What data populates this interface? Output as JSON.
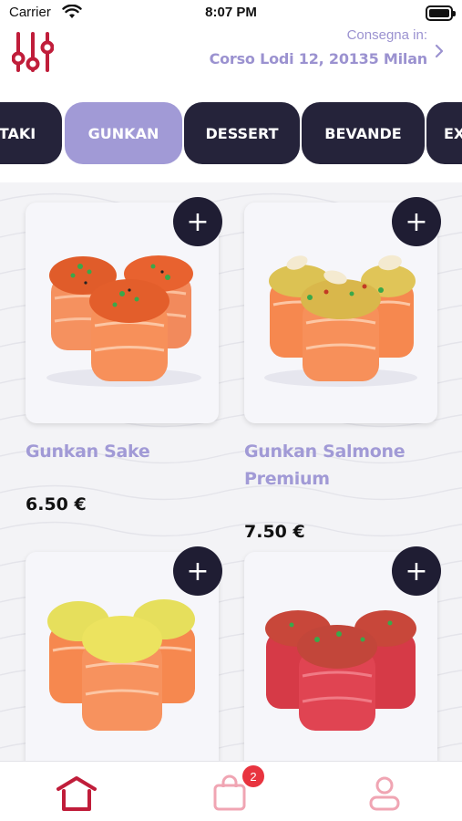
{
  "status_bar": {
    "carrier": "Carrier",
    "time": "8:07 PM"
  },
  "header": {
    "filter_icon": "sliders-icon",
    "delivery_label": "Consegna in:",
    "delivery_address": "Corso Lodi 12, 20135 Milan",
    "chevron_icon": "chevron-right-icon"
  },
  "categories": [
    {
      "label": "TAKI",
      "active": false
    },
    {
      "label": "GUNKAN",
      "active": true
    },
    {
      "label": "DESSERT",
      "active": false
    },
    {
      "label": "BEVANDE",
      "active": false
    },
    {
      "label": "EX",
      "active": false
    }
  ],
  "products": [
    {
      "name_line1": "Gunkan Sake",
      "name_line2": "",
      "price": "6.50 €",
      "add_label": "+"
    },
    {
      "name_line1": "Gunkan Salmone",
      "name_line2": "Premium",
      "price": "7.50 €",
      "add_label": "+"
    },
    {
      "name_line1": "",
      "name_line2": "",
      "price": "",
      "add_label": "+"
    },
    {
      "name_line1": "",
      "name_line2": "",
      "price": "",
      "add_label": "+"
    }
  ],
  "tabbar": {
    "home_icon": "home-icon",
    "cart_icon": "shopping-bag-icon",
    "cart_badge": "2",
    "profile_icon": "user-icon"
  },
  "colors": {
    "accent": "#a19ad6",
    "dark": "#25233a",
    "brand_red": "#c01d3a",
    "badge": "#e8343f"
  }
}
